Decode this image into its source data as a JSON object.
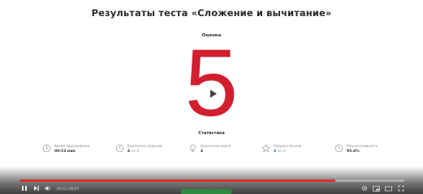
{
  "header": {
    "title": "Результаты теста «Сложение и вычитание»"
  },
  "grade": {
    "label": "Оценка",
    "value": "5"
  },
  "stats_section": {
    "label": "Статистика",
    "items": [
      {
        "icon": "clock-icon",
        "name": "Время прохождения",
        "value": "00:53 мин"
      },
      {
        "icon": "clock-icon",
        "name": "Выполнено заданий",
        "value": "4",
        "extra": "из 4"
      },
      {
        "icon": "bulb-icon",
        "name": "Выполнено верно",
        "value": "4"
      },
      {
        "icon": "star-icon",
        "name": "Набрано баллов",
        "value": "4",
        "extra": "из 4"
      },
      {
        "icon": "clock-icon",
        "name": "Результативность",
        "value": "95.4%"
      }
    ]
  },
  "player": {
    "time": "00:11 / 00:57",
    "progress": 0.82,
    "colors": {
      "progress": "#e1302a",
      "accent": "#2d8a3e"
    }
  },
  "colors": {
    "grade": "#d11f2f"
  }
}
